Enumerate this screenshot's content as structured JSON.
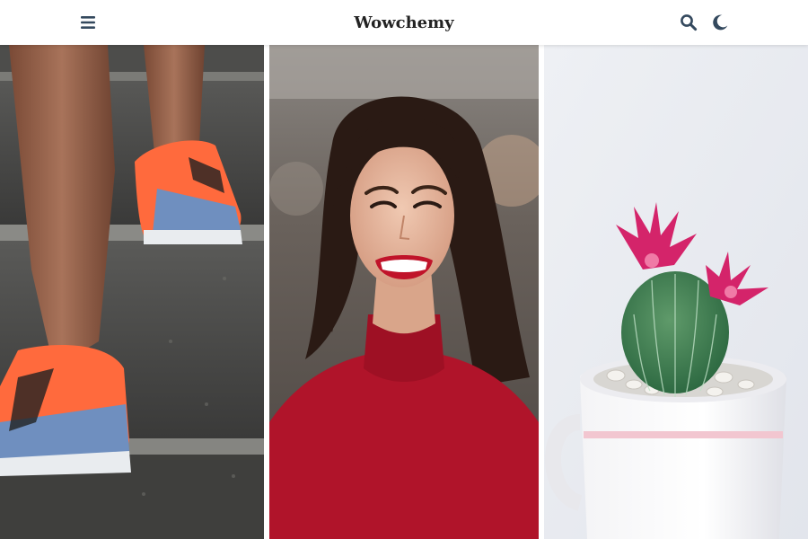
{
  "navbar": {
    "brand": "Wowchemy",
    "menu_icon": "hamburger-menu-icon",
    "search_icon": "search-icon",
    "theme_icon": "moon-icon"
  },
  "gallery": {
    "photos": [
      {
        "subject": "running-shoes-on-stairs"
      },
      {
        "subject": "smiling-woman-red-top"
      },
      {
        "subject": "flowering-cactus-in-mug"
      }
    ]
  },
  "colors": {
    "icon": "#34495e",
    "brand_text": "#222222",
    "navbar_bg": "#ffffff"
  }
}
